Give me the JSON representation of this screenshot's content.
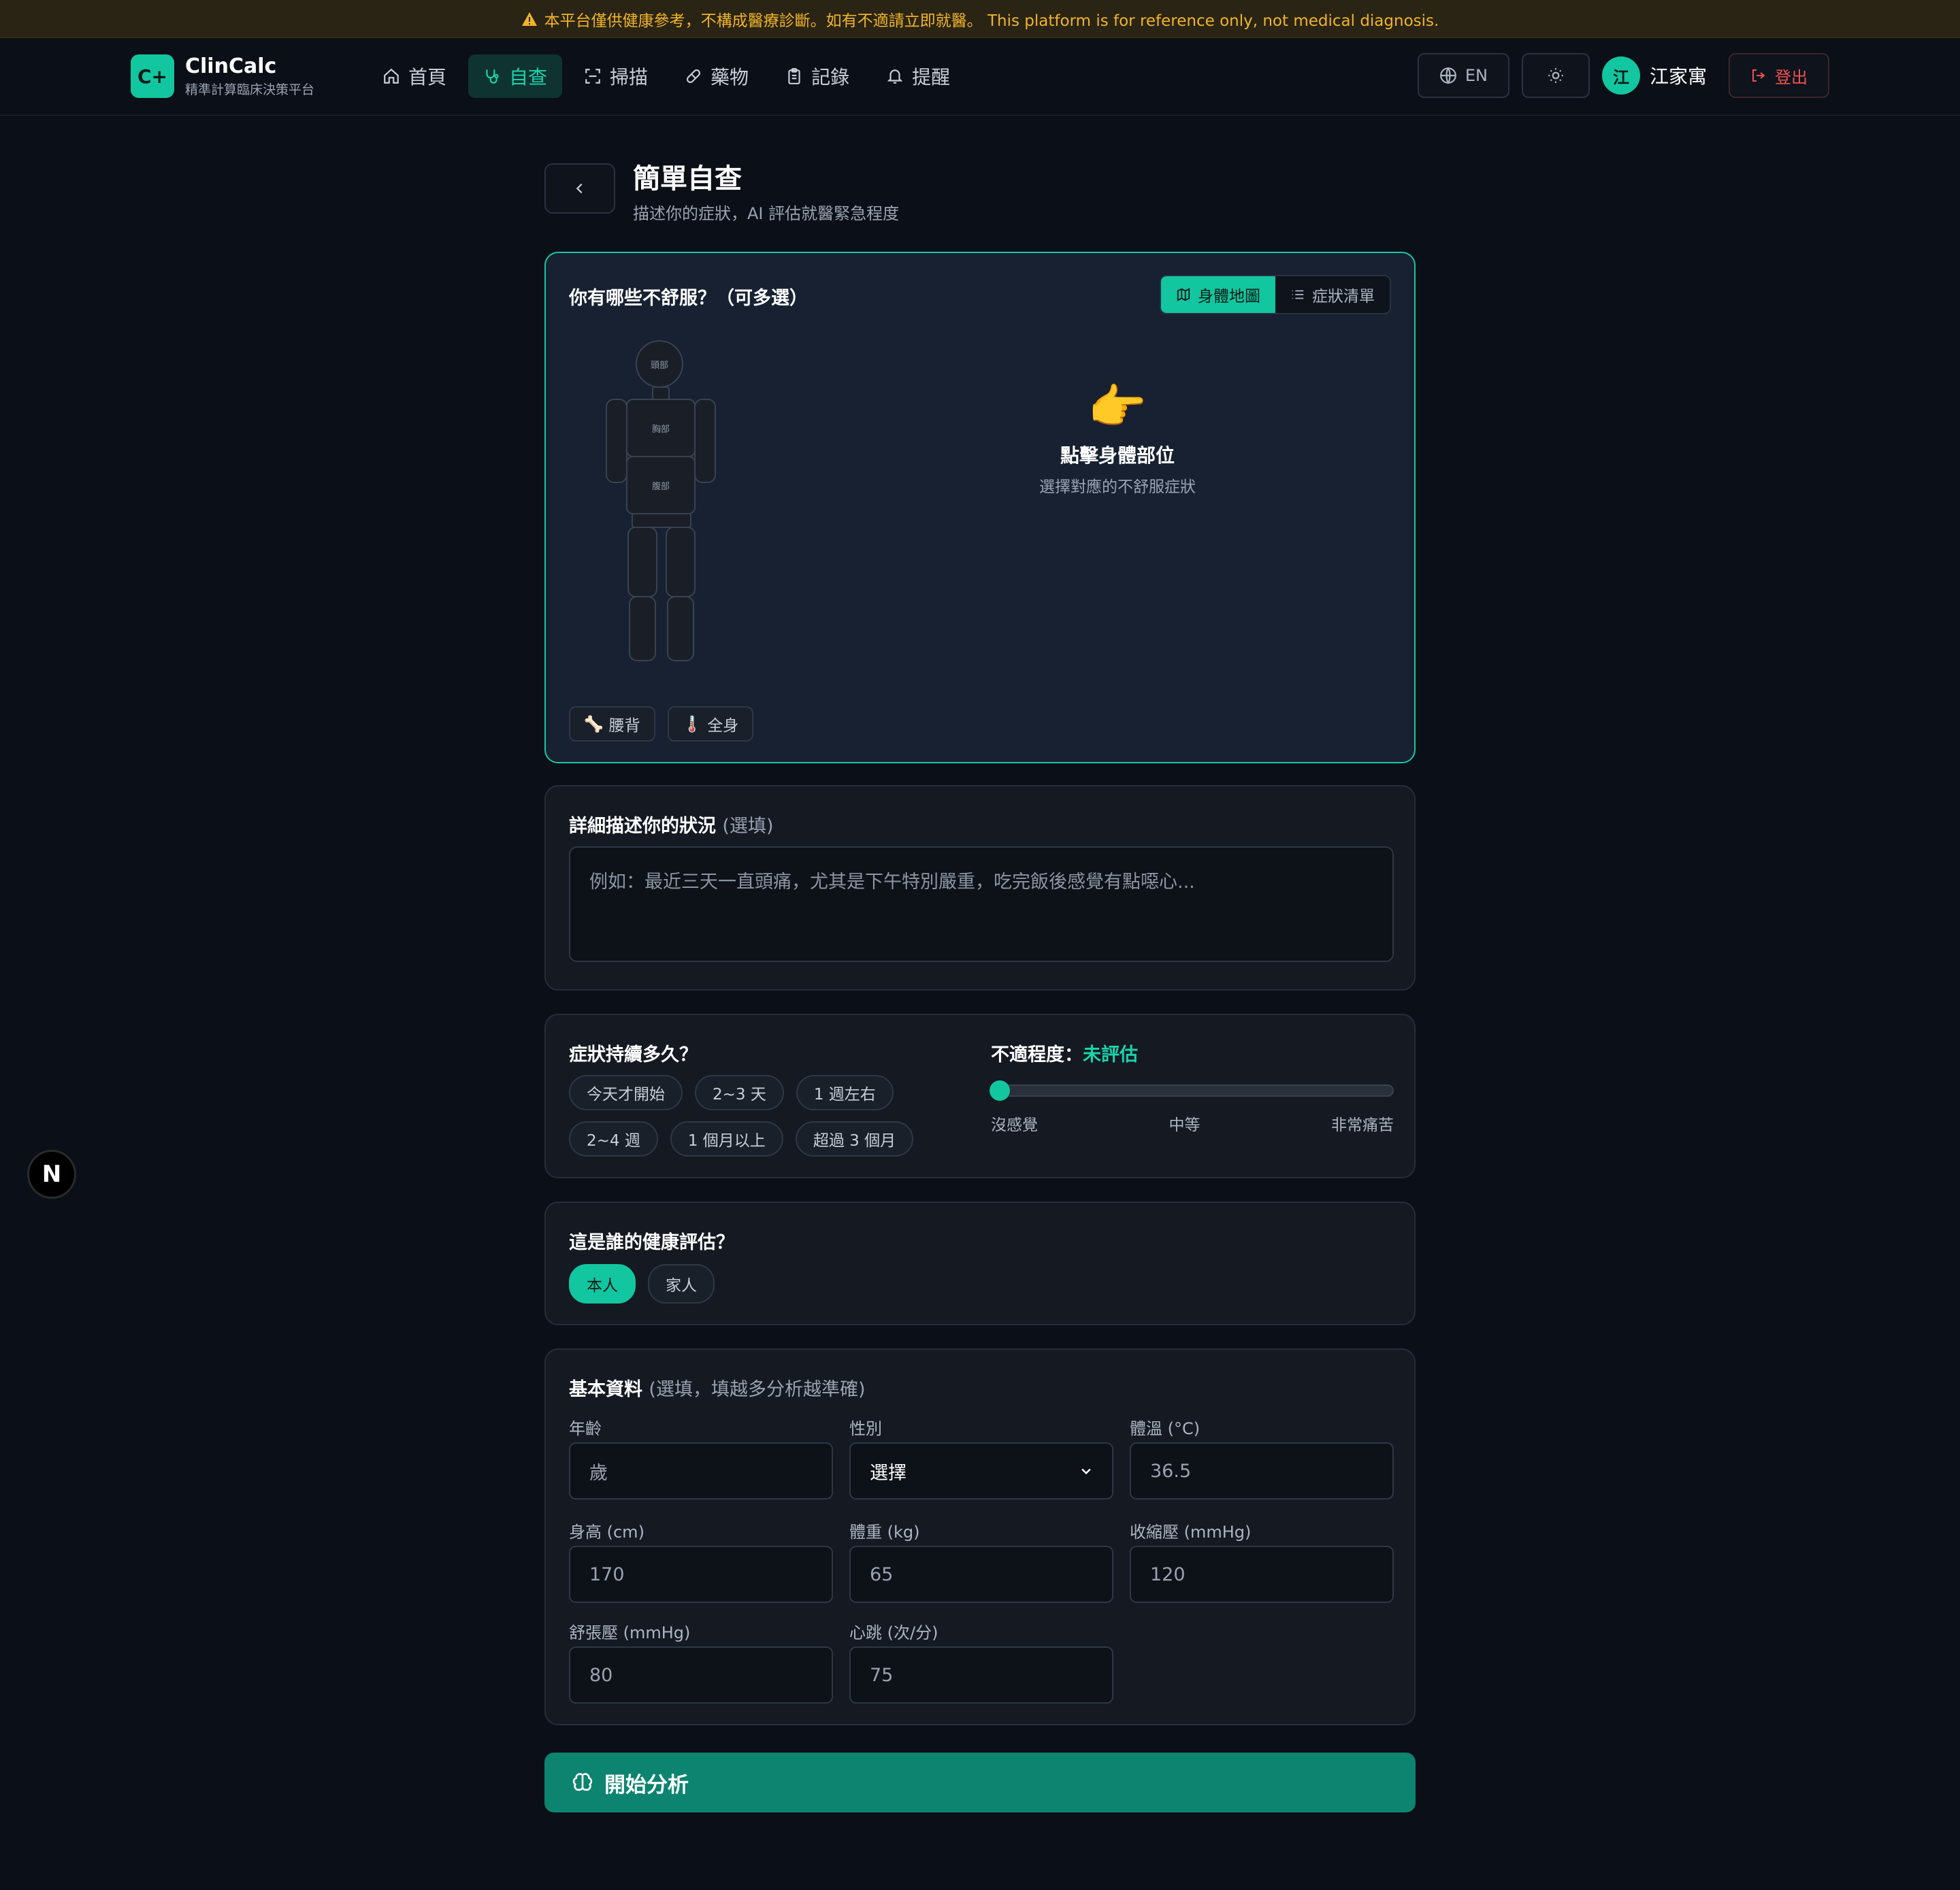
{
  "banner": {
    "text": "本平台僅供健康參考，不構成醫療診斷。如有不適請立即就醫。 This platform is for reference only, not medical diagnosis."
  },
  "brand": {
    "logo": "C+",
    "name": "ClinCalc",
    "tagline": "精準計算臨床決策平台",
    "accent": "#12c6a0"
  },
  "nav": {
    "items": [
      {
        "label": "首頁",
        "icon": "home-icon"
      },
      {
        "label": "自查",
        "icon": "stethoscope-icon",
        "active": true
      },
      {
        "label": "掃描",
        "icon": "scan-icon"
      },
      {
        "label": "藥物",
        "icon": "pill-icon"
      },
      {
        "label": "記錄",
        "icon": "clipboard-icon"
      },
      {
        "label": "提醒",
        "icon": "bell-icon"
      }
    ],
    "lang": "EN",
    "user_initial": "江",
    "user_name": "江家寓",
    "logout": "登出"
  },
  "page": {
    "title": "簡單自查",
    "subtitle": "描述你的症狀，AI 評估就醫緊急程度"
  },
  "symptoms": {
    "title": "你有哪些不舒服？（可多選）",
    "tabs": [
      "身體地圖",
      "症狀清單"
    ],
    "body_labels": {
      "head": "頭部",
      "chest": "胸部",
      "abdomen": "腹部"
    },
    "hint_icon": "👉",
    "hint_title": "點擊身體部位",
    "hint_sub": "選擇對應的不舒服症狀",
    "extra_chips": [
      {
        "icon": "🦴",
        "label": "腰背"
      },
      {
        "icon": "🌡️",
        "label": "全身"
      }
    ]
  },
  "details": {
    "title": "詳細描述你的狀況",
    "optional": "(選填)",
    "placeholder": "例如：最近三天一直頭痛，尤其是下午特別嚴重，吃完飯後感覺有點噁心..."
  },
  "duration": {
    "title": "症狀持續多久？",
    "options": [
      "今天才開始",
      "2~3 天",
      "1 週左右",
      "2~4 週",
      "1 個月以上",
      "超過 3 個月"
    ]
  },
  "severity": {
    "title": "不適程度：",
    "value_text": "未評估",
    "level": 0,
    "scale": [
      "沒感覺",
      "中等",
      "非常痛苦"
    ]
  },
  "subject": {
    "title": "這是誰的健康評估？",
    "options": [
      "本人",
      "家人"
    ],
    "selected": "本人"
  },
  "basic": {
    "title": "基本資料",
    "optional": "(選填，填越多分析越準確)",
    "fields": [
      {
        "label": "年齡",
        "value": "歲"
      },
      {
        "label": "性別",
        "value": "選擇"
      },
      {
        "label": "體溫 (°C)",
        "value": "36.5"
      },
      {
        "label": "身高 (cm)",
        "value": "170"
      },
      {
        "label": "體重 (kg)",
        "value": "65"
      },
      {
        "label": "收縮壓 (mmHg)",
        "value": "120"
      },
      {
        "label": "舒張壓 (mmHg)",
        "value": "80"
      },
      {
        "label": "心跳 (次/分)",
        "value": "75"
      }
    ]
  },
  "cta": {
    "label": "開始分析"
  },
  "fab": {
    "label": "N"
  }
}
